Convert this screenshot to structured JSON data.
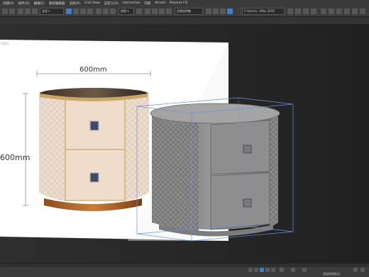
{
  "menubar": {
    "items": [
      "创建(A)",
      "组件(D)",
      "编辑(E)",
      "图形编辑器",
      "渲染(R)",
      "Civil View",
      "自定义(U)",
      "Interactive",
      "内容",
      "Arnold",
      "Phoenix FD"
    ]
  },
  "toolbar": {
    "selection_set_dropdown": "创建选择集",
    "workspace_dropdown": "C:\\Users\\...\\Max 2020"
  },
  "viewport": {
    "label": "[透视]",
    "reference_image": {
      "width_label": "600mm",
      "height_label": "600mm"
    }
  },
  "statusbar": {
    "left_text": "",
    "right_text": "添加时间标记"
  },
  "colors": {
    "ui_dark": "#2b2b2b",
    "bbox_blue": "#6b8fe6",
    "model_gray": "#8c8c8c"
  }
}
